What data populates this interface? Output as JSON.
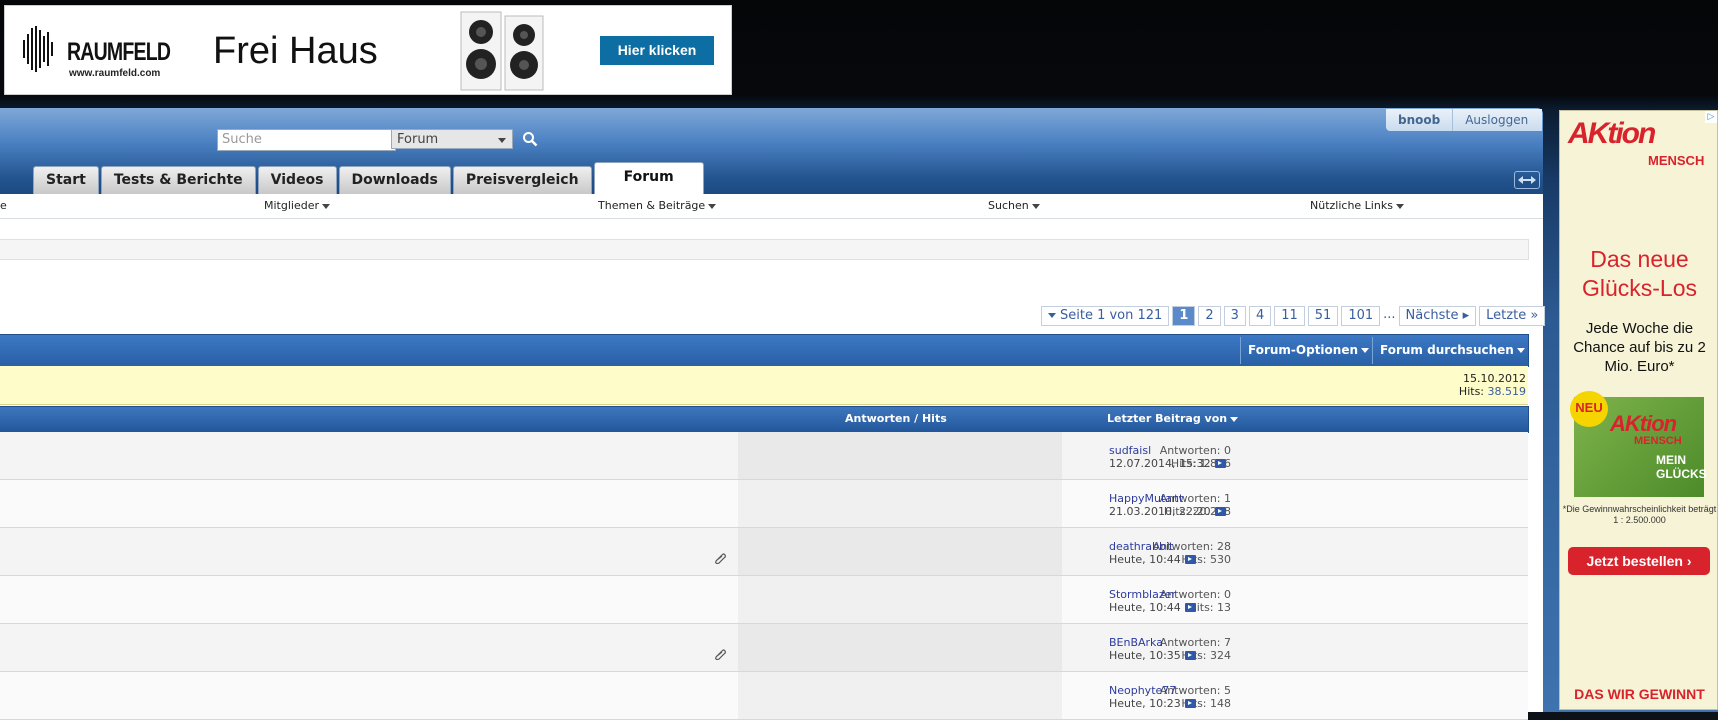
{
  "top_banner": {
    "brand": "RAUMFELD",
    "url": "www.raumfeld.com",
    "headline": "Frei Haus",
    "cta": "Hier klicken"
  },
  "header": {
    "username": "bnoob",
    "logout": "Ausloggen",
    "search_placeholder": "Suche",
    "search_scope": "Forum"
  },
  "tabs": [
    "Start",
    "Tests & Berichte",
    "Videos",
    "Downloads",
    "Preisvergleich",
    "Forum"
  ],
  "subnav": {
    "first_partial": "e",
    "members": "Mitglieder",
    "topics": "Themen & Beiträge",
    "search": "Suchen",
    "links": "Nützliche Links"
  },
  "pagination": {
    "label": "Seite 1 von 121",
    "pages": [
      "1",
      "2",
      "3",
      "4",
      "11",
      "51",
      "101"
    ],
    "current": "1",
    "ellipsis": "...",
    "next": "Nächste",
    "last": "Letzte"
  },
  "forum_bar": {
    "options": "Forum-Optionen",
    "search": "Forum durchsuchen"
  },
  "announcement": {
    "date": "15.10.2012",
    "hits_label": "Hits:",
    "hits_value": "38.519"
  },
  "thread_header": {
    "stats": "Antworten / Hits",
    "last_post": "Letzter Beitrag von"
  },
  "threads": [
    {
      "replies": "Antworten: 0",
      "hits": "Hits: 1.846",
      "user": "sudfaisl",
      "date": "12.07.2014, 15:32",
      "attachment": false
    },
    {
      "replies": "Antworten: 1",
      "hits": "Hits: 20.298",
      "user": "HappyMutant",
      "date": "21.03.2010, 22:20",
      "attachment": false
    },
    {
      "replies": "Antworten: 28",
      "hits": "Hits: 530",
      "user": "deathrabbit",
      "date": "Heute, 10:44",
      "attachment": true
    },
    {
      "replies": "Antworten: 0",
      "hits": "Hits: 13",
      "user": "Stormblazer",
      "date": "Heute, 10:44",
      "attachment": false
    },
    {
      "replies": "Antworten: 7",
      "hits": "Hits: 324",
      "user": "BEnBArka",
      "date": "Heute, 10:35",
      "attachment": true
    },
    {
      "replies": "Antworten: 5",
      "hits": "Hits: 148",
      "user": "Neophyte77",
      "date": "Heute, 10:23",
      "attachment": false
    }
  ],
  "right_ad": {
    "corner": "▷",
    "logo": "AKtion",
    "logo_sub": "MENSCH",
    "headline": "Das neue Glücks-Los",
    "text": "Jede Woche die Chance auf bis zu 2 Mio. Euro*",
    "badge": "NEU",
    "card_logo": "AKtion",
    "card_logo_sub": "MENSCH",
    "card_text": "MEIN GLÜCKS",
    "fine_print": "*Die Gewinnwahrscheinlichkeit beträgt 1 : 2.500.000",
    "button": "Jetzt bestellen",
    "footer": "DAS WIR GEWINNT"
  },
  "colors": {
    "header_blue": "#2c5a92",
    "link_blue": "#2c3b9e",
    "announce_yellow": "#fefcc9",
    "ad_red": "#d9232c"
  }
}
